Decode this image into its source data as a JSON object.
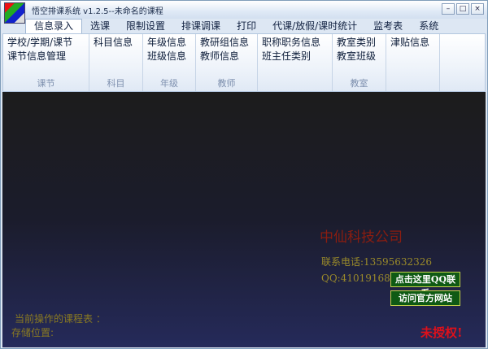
{
  "window": {
    "title": "悟空排课系统 v1.2.5--未命名的课程"
  },
  "tabs": [
    {
      "label": "信息录入"
    },
    {
      "label": "选课"
    },
    {
      "label": "限制设置"
    },
    {
      "label": "排课调课"
    },
    {
      "label": "打印"
    },
    {
      "label": "代课/放假/课时统计"
    },
    {
      "label": "监考表"
    },
    {
      "label": "系统"
    }
  ],
  "ribbon": {
    "groups": [
      {
        "label": "课节",
        "items": [
          "学校/学期/课节",
          "课节信息管理"
        ]
      },
      {
        "label": "科目",
        "items": [
          "科目信息"
        ]
      },
      {
        "label": "年级",
        "items": [
          "年级信息",
          "班级信息"
        ]
      },
      {
        "label": "教师",
        "items": [
          "教研组信息",
          "教师信息"
        ]
      },
      {
        "label": "",
        "items": [
          "职称职务信息",
          "班主任类别"
        ]
      },
      {
        "label": "教室",
        "items": [
          "教室类别",
          "教室班级"
        ]
      },
      {
        "label": "",
        "items": [
          "津贴信息"
        ]
      }
    ]
  },
  "main": {
    "company": "中仙科技公司",
    "phone": "联系电话:13595632326",
    "qq": "QQ:410191680",
    "qq_button": "点击这里QQ联系",
    "site_button": "访问官方网站",
    "current_table": "当前操作的课程表 ：",
    "storage": "存储位置:",
    "unauthorized": "未授权!"
  },
  "colors": {
    "accent": "#0f5a14",
    "warning": "#e0101a"
  }
}
